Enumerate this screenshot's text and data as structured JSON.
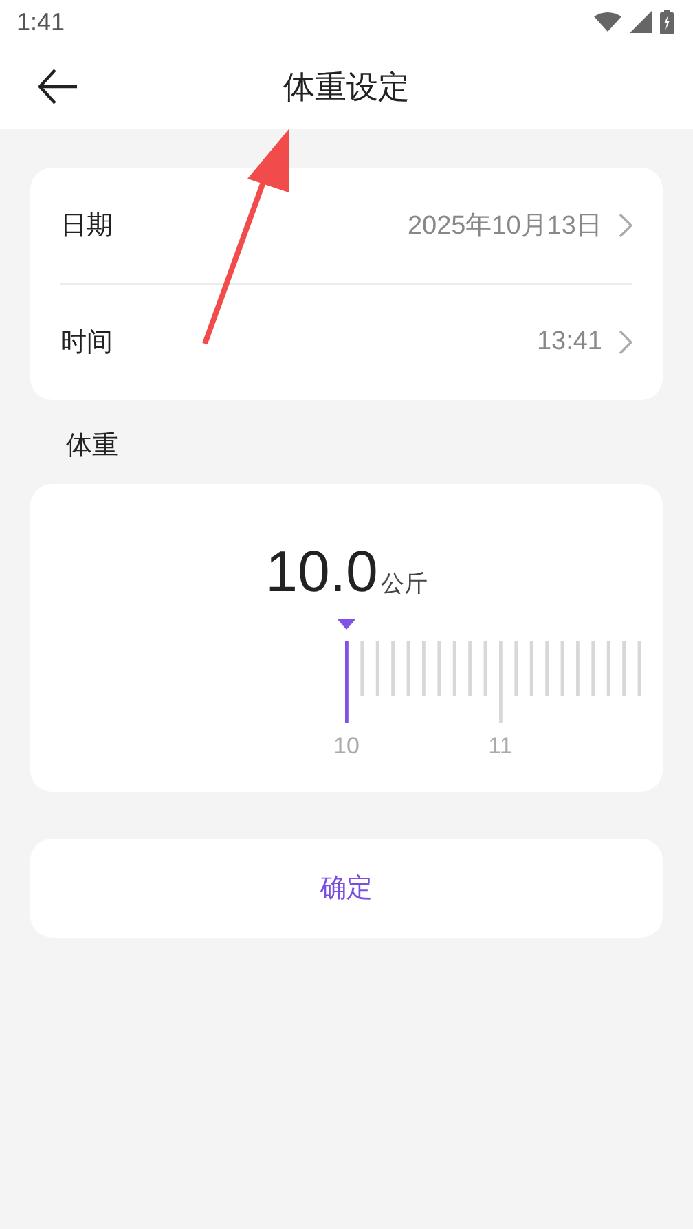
{
  "status_bar": {
    "time": "1:41"
  },
  "header": {
    "title": "体重设定"
  },
  "settings": [
    {
      "label": "日期",
      "value": "2025年10月13日"
    },
    {
      "label": "时间",
      "value": "13:41"
    }
  ],
  "weight": {
    "label": "体重",
    "value": "10.0",
    "unit": "公斤",
    "ruler_labels": [
      "10",
      "11"
    ]
  },
  "confirm_button": "确定",
  "annotation": {
    "kind": "arrow"
  }
}
